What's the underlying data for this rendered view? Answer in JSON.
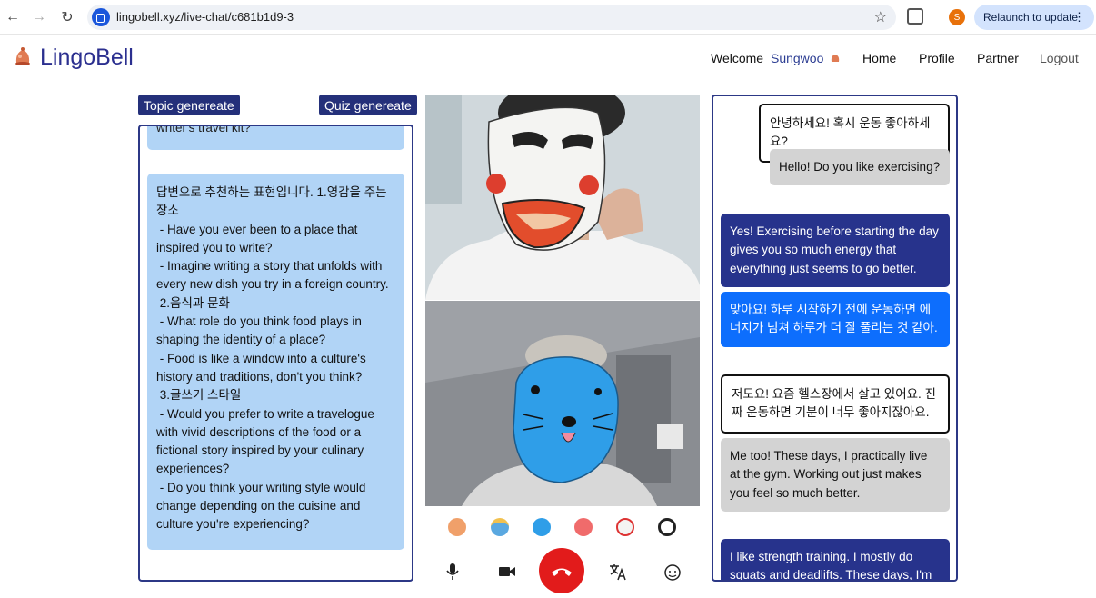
{
  "browser": {
    "url": "lingobell.xyz/live-chat/c681b1d9-3",
    "profile_initial": "S",
    "relaunch_label": "Relaunch to update"
  },
  "header": {
    "app_name": "LingoBell",
    "welcome_label": "Welcome",
    "user_name": "Sungwoo",
    "nav": [
      "Home",
      "Profile",
      "Partner",
      "Logout"
    ]
  },
  "left": {
    "topic_button": "Topic genereate",
    "quiz_button": "Quiz genereate",
    "cut_text": "writer's travel kit?",
    "suggestion_text": "답변으로 추천하는 표현입니다. 1.영감을 주는 장소\n - Have you ever been to a place that inspired you to write?\n - Imagine writing a story that unfolds with every new dish you try in a foreign country.\n 2.음식과 문화\n - What role do you think food plays in shaping the identity of a place?\n - Food is like a window into a culture's history and traditions, don't you think?\n 3.글쓰기 스타일\n - Would you prefer to write a travelogue with vivid descriptions of the food or a fictional story inspired by your culinary experiences?\n - Do you think your writing style would change depending on the cuisine and culture you're experiencing?"
  },
  "video": {
    "emojis": [
      "bear-face-icon",
      "blue-mask-icon",
      "blue-bird-face-icon",
      "red-face-icon",
      "mask-face-icon",
      "panda-face-icon"
    ]
  },
  "chat": {
    "messages": [
      {
        "text": "안녕하세요! 혹시 운동 좋아하세요?",
        "style": "outline"
      },
      {
        "text": "Hello! Do you like exercising?",
        "style": "grey"
      },
      {
        "text": "Yes! Exercising before starting the day gives you so much energy that everything just seems to go better.",
        "style": "navy"
      },
      {
        "text": "맞아요! 하루 시작하기 전에 운동하면 에너지가 넘쳐 하루가 더 잘 풀리는 것 같아.",
        "style": "blue"
      },
      {
        "text": "저도요! 요즘 헬스장에서 살고 있어요. 진짜 운동하면 기분이 너무 좋아지잖아요.",
        "style": "outline"
      },
      {
        "text": "Me too! These days, I practically live at the gym. Working out just makes you feel so much better.",
        "style": "grey"
      },
      {
        "text": "I like strength training. I mostly do squats and deadlifts. These days, I'm",
        "style": "navy"
      }
    ]
  },
  "colors": {
    "primary_navy": "#24307a",
    "suggestion_blue": "#b1d4f6",
    "bright_blue": "#0d6efd",
    "end_call_red": "#e21b1b"
  }
}
